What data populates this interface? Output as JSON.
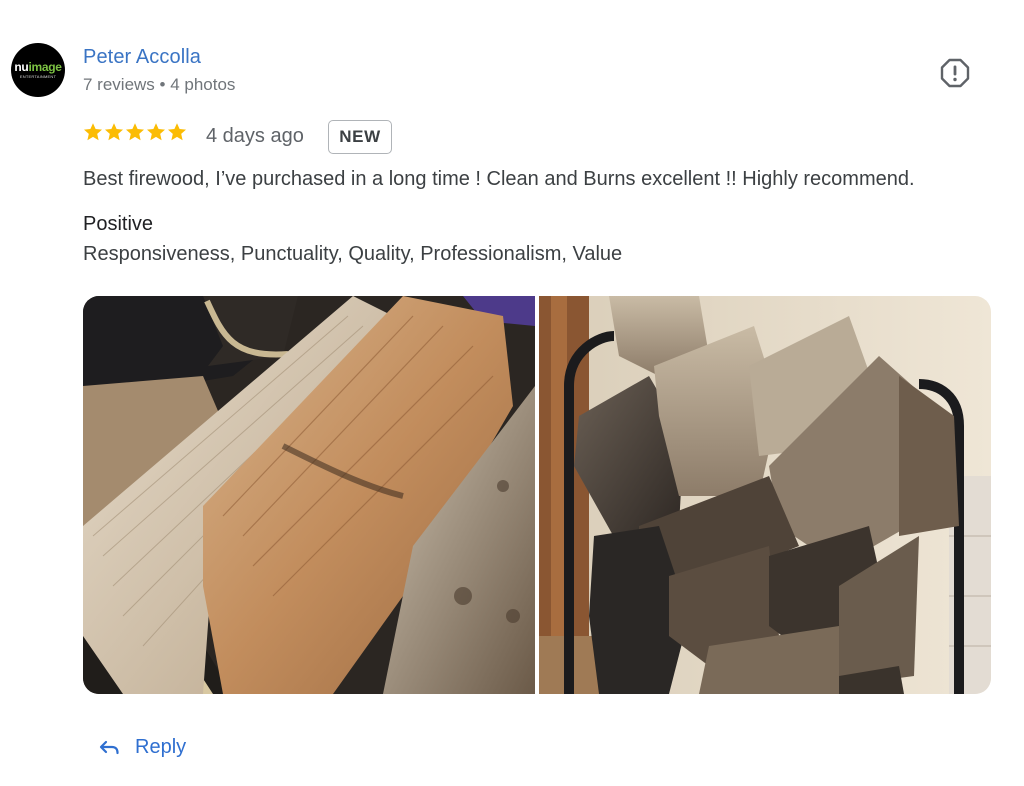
{
  "reviewer": {
    "avatar_logo_main_white": "nu",
    "avatar_logo_main_green": "image",
    "avatar_logo_sub": "ENTERTAINMENT",
    "name": "Peter Accolla",
    "meta": "7 reviews • 4 photos"
  },
  "review": {
    "rating": 5,
    "rating_max": 5,
    "time_ago": "4 days ago",
    "badge": "NEW",
    "text": "Best firewood, I’ve purchased in a long time ! Clean and Burns excellent !! Highly recommend.",
    "positive_label": "Positive",
    "positive_values": "Responsiveness, Punctuality, Quality, Professionalism, Value",
    "photos": [
      {
        "icon": "firewood-closeup-photo"
      },
      {
        "icon": "firewood-rack-photo"
      }
    ]
  },
  "actions": {
    "reply_label": "Reply",
    "report_icon": "report-icon"
  },
  "colors": {
    "link": "#3a74c4",
    "star": "#fbbc04",
    "meta": "#70757a",
    "text": "#3c4043"
  }
}
